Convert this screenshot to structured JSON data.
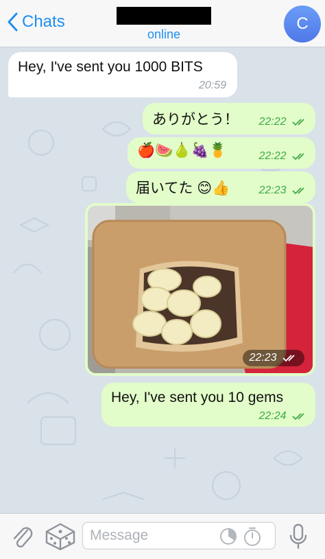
{
  "header": {
    "back_label": "Chats",
    "status": "online",
    "avatar_letter": "C"
  },
  "messages": [
    {
      "dir": "in",
      "text": "Hey, I've sent you 1000 BITS",
      "time": "20:59"
    },
    {
      "dir": "out",
      "text": "ありがとう！",
      "time": "22:22"
    },
    {
      "dir": "out",
      "text": "🍎🍉🍐🍇🍍",
      "time": "22:22"
    },
    {
      "dir": "out",
      "text": "届いてた 😊👍",
      "time": "22:23"
    },
    {
      "dir": "out",
      "type": "photo",
      "time": "22:23"
    },
    {
      "dir": "out",
      "text": "Hey, I've sent you 10 gems",
      "time": "22:24"
    }
  ],
  "composer": {
    "placeholder": "Message"
  },
  "colors": {
    "accent": "#1d8ff0",
    "outgoing_bubble": "#e2fdc9",
    "incoming_bubble": "#ffffff",
    "outgoing_time": "#3fa84a"
  },
  "icons": [
    "chevron-left-icon",
    "paperclip-icon",
    "dice-icon",
    "moon-clock-icon",
    "timer-icon",
    "microphone-icon",
    "double-check-icon"
  ]
}
